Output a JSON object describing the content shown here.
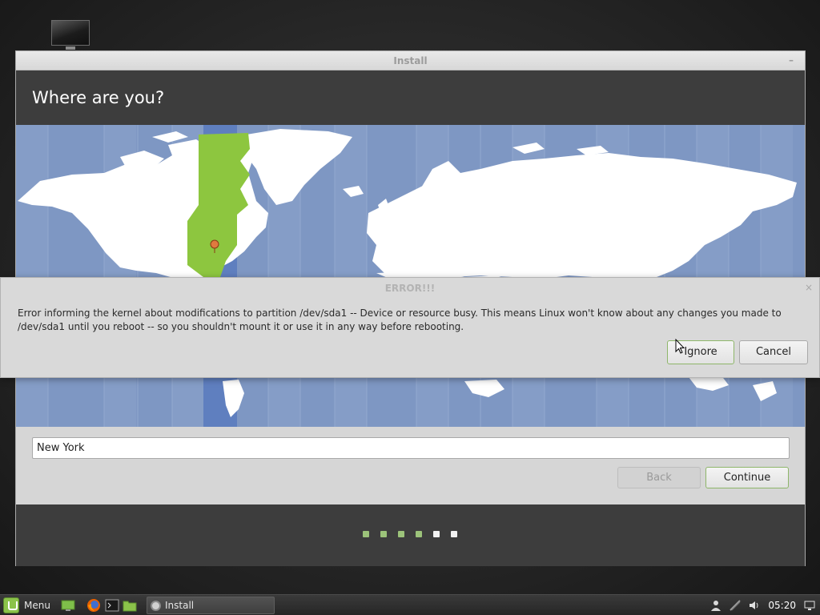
{
  "window": {
    "title": "Install",
    "minimize_glyph": "–",
    "heading": "Where are you?"
  },
  "location": {
    "city_value": "New York"
  },
  "buttons": {
    "back": "Back",
    "continue": "Continue"
  },
  "progress": {
    "total_steps": 6,
    "completed_steps": 4,
    "colors": {
      "done": "#9cc37a",
      "todo": "#f2f2f2"
    }
  },
  "error_dialog": {
    "title": "ERROR!!!",
    "close_glyph": "×",
    "message": "Error informing the kernel about modifications to partition /dev/sda1 -- Device or resource busy. This means Linux won't know about any changes you made to /dev/sda1 until you reboot -- so you shouldn't mount it or use it in any way before rebooting.",
    "ignore": "Ignore",
    "cancel": "Cancel"
  },
  "taskbar": {
    "menu_label": "Menu",
    "task_label": "Install",
    "clock": "05:20",
    "launchers": [
      "show-desktop-icon",
      "firefox-icon",
      "terminal-icon",
      "files-icon"
    ],
    "tray_icons": [
      "user-icon",
      "network-icon",
      "volume-icon",
      "display-icon"
    ]
  },
  "map": {
    "ocean_color": "#7e97c3",
    "land_color": "#ffffff",
    "highlight_color": "#8dc63f",
    "selected_zone_color": "#5f7fbf",
    "pin_color": "#e07a3f"
  }
}
